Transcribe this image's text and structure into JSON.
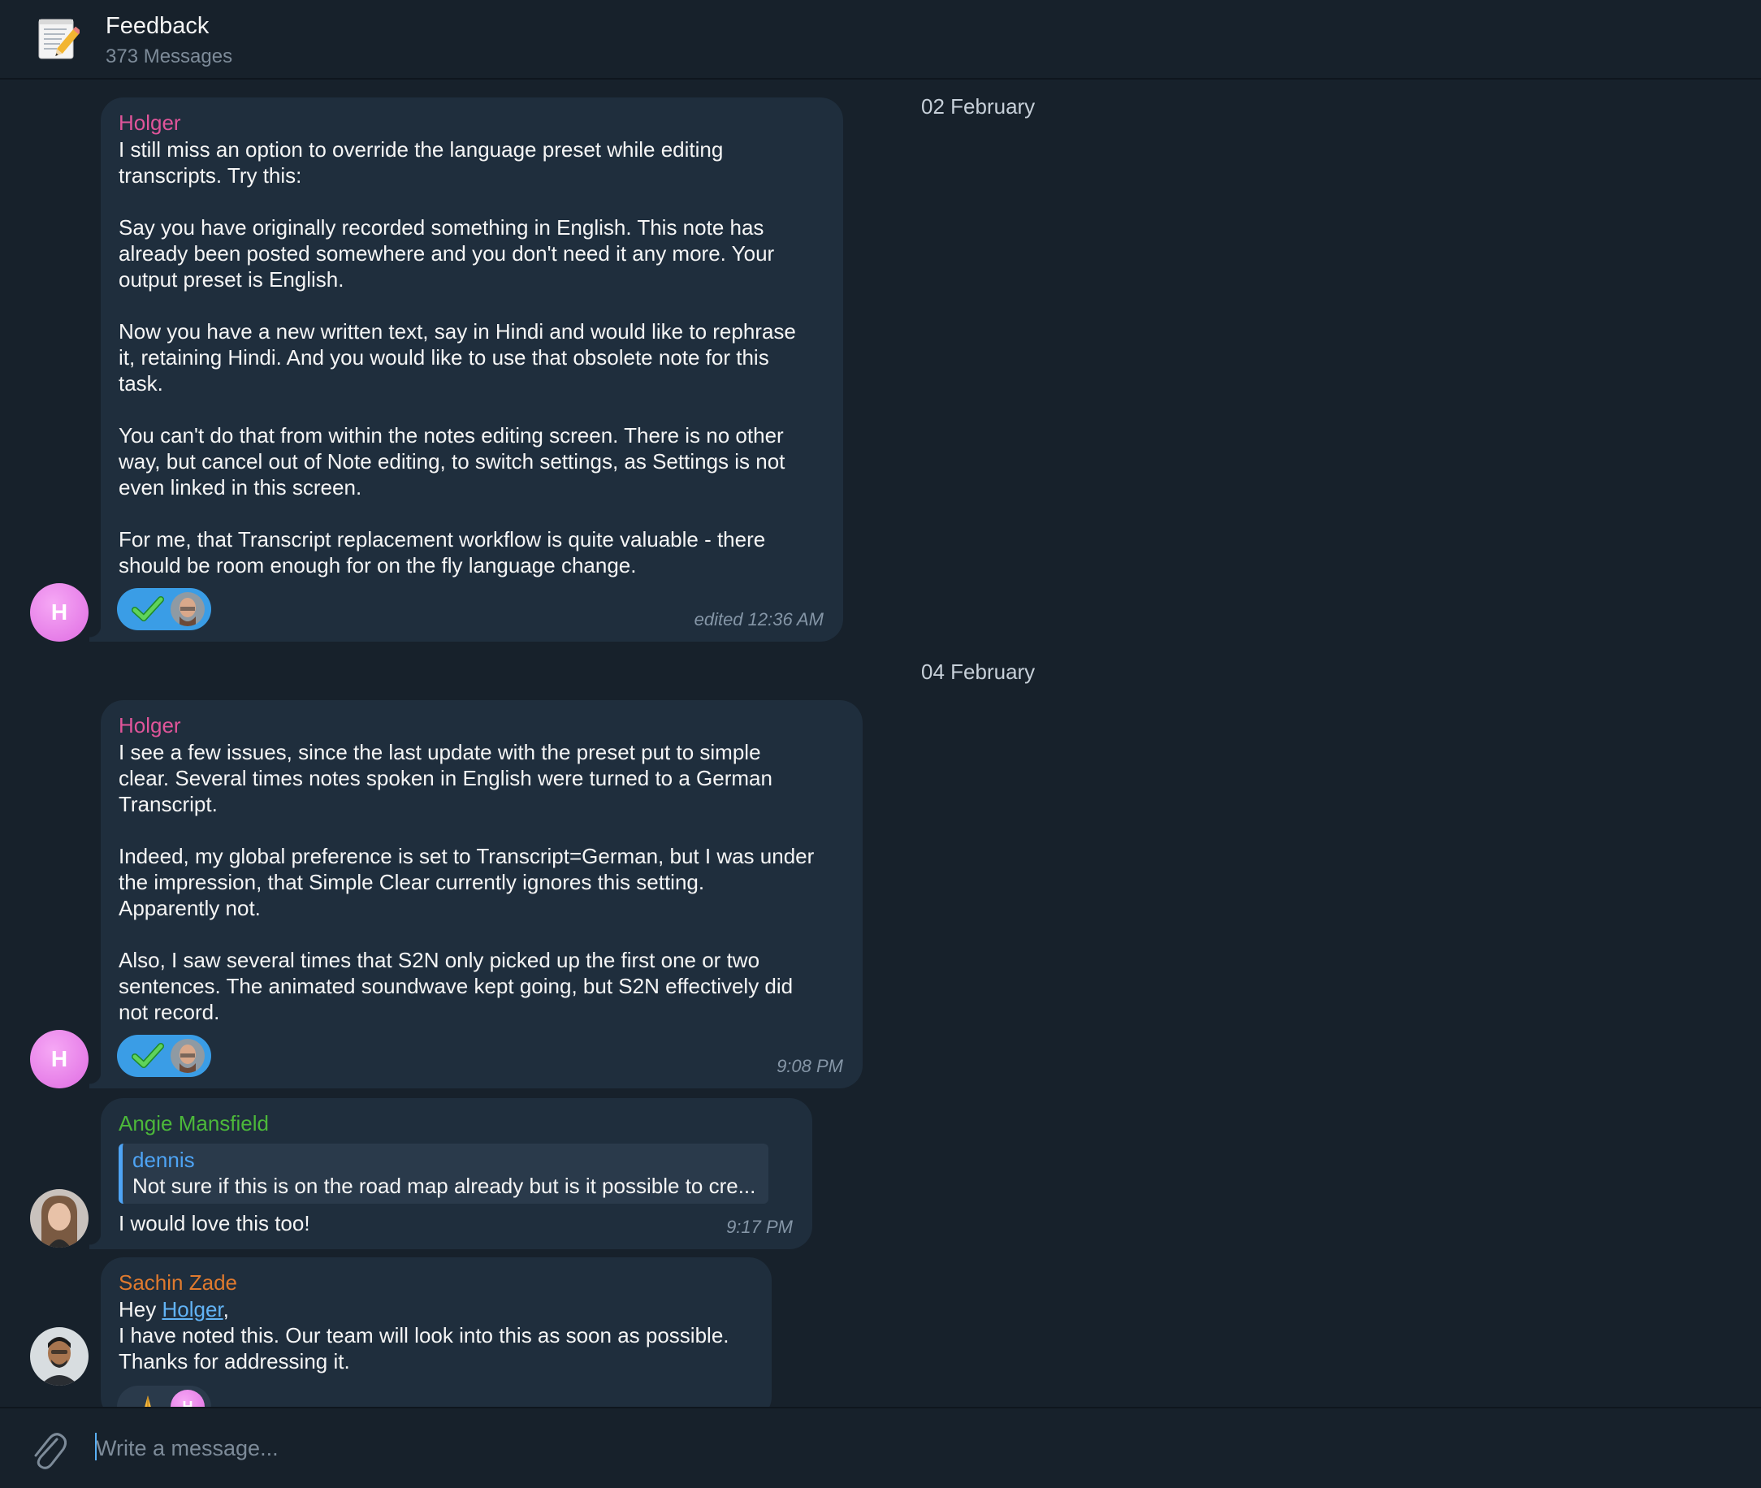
{
  "header": {
    "title": "Feedback",
    "subtitle": "373 Messages",
    "icon": "memo-pencil-icon"
  },
  "dates": [
    "02 February",
    "04 February"
  ],
  "messages": [
    {
      "sender": "Holger",
      "sender_color": "#e0559a",
      "avatar_letter": "H",
      "text": "I still miss an option to override the language preset while editing\ntranscripts. Try this:\n\nSay you have originally recorded something in English. This note has\nalready been posted somewhere and you don't need it any more. Your\noutput preset is English.\n\nNow you have a new written text, say in Hindi and would like to rephrase\nit, retaining Hindi. And you would like to use that obsolete note for this\ntask.\n\nYou can't do that from within the notes editing screen. There is no other\nway, but cancel out of Note editing, to switch settings, as Settings is not\neven linked in this screen.\n\nFor me, that Transcript replacement workflow is quite valuable - there\nshould be room enough for on the fly language change.",
      "time": "edited 12:36 AM",
      "reaction": "check-mark-emoji"
    },
    {
      "sender": "Holger",
      "sender_color": "#e0559a",
      "avatar_letter": "H",
      "text": "I see a few issues, since the last update with the preset put to simple\nclear. Several times notes spoken in English were turned to a German\nTranscript.\n\nIndeed, my global preference is set to Transcript=German, but I was under\nthe impression, that Simple Clear currently ignores this setting.\nApparently not.\n\nAlso, I saw several times that S2N only picked up the first one or two\nsentences. The animated soundwave kept going, but S2N effectively did\nnot record.",
      "time": "9:08 PM",
      "reaction": "check-mark-emoji"
    },
    {
      "sender": "Angie Mansfield",
      "sender_color": "#4cb83a",
      "reply_author": "dennis",
      "reply_text": "Not sure if this is on the road map already but is it possible to cre...",
      "text": "I would love this too!",
      "time": "9:17 PM"
    },
    {
      "sender": "Sachin Zade",
      "sender_color": "#e07a2e",
      "text_prefix": "Hey ",
      "mention": "Holger",
      "text_suffix": ",",
      "text": "I have noted this. Our team will look into this as soon as possible.\nThanks for addressing it.",
      "reaction": "folded-hands-emoji",
      "reaction_avatar_letter": "H"
    }
  ],
  "composer": {
    "placeholder": "Write a message...",
    "attach_icon": "paperclip-icon"
  }
}
